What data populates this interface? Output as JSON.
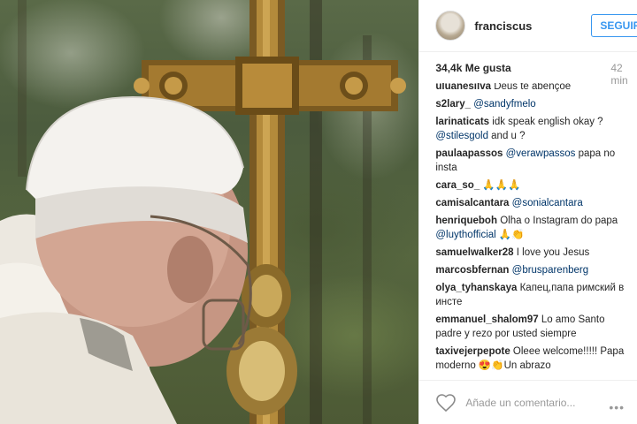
{
  "post": {
    "username": "franciscus",
    "follow_label": "SEGUIR",
    "likes": "34,4k Me gusta",
    "time": "42 min"
  },
  "comments": [
    {
      "user": "uluanesilva",
      "text": "Deus te abençoe",
      "mention": ""
    },
    {
      "user": "s2lary_",
      "text": "",
      "mention": "@sandyfmelo"
    },
    {
      "user": "larinaticats",
      "text": "idk speak english okay ?",
      "mention": "@stilesgold",
      "after": " and u ?"
    },
    {
      "user": "paulaapassos",
      "text": "",
      "mention": "@verawpassos",
      "after": " papa no insta"
    },
    {
      "user": "cara_so_",
      "text": "🙏🙏🙏",
      "mention": ""
    },
    {
      "user": "camisalcantara",
      "text": "",
      "mention": "@sonialcantara"
    },
    {
      "user": "henriqueboh",
      "text": "Olha o Instagram do papa",
      "mention": "@luythofficial",
      "after": " 🙏👏"
    },
    {
      "user": "samuelwalker28",
      "text": "I love you Jesus",
      "mention": ""
    },
    {
      "user": "marcosbfernan",
      "text": "",
      "mention": "@brusparenberg"
    },
    {
      "user": "olya_tyhanskaya",
      "text": "Капец,папа римский в инсте",
      "mention": ""
    },
    {
      "user": "emmanuel_shalom97",
      "text": "Lo amo Santo padre y rezo por usted siempre",
      "mention": ""
    },
    {
      "user": "taxivejerpepote",
      "text": "Oleee welcome!!!!! Papa moderno 😍👏Un abrazo",
      "mention": ""
    }
  ],
  "footer": {
    "add_comment_placeholder": "Añade un comentario...",
    "more_icon": "ellipsis-icon",
    "like_icon": "heart-icon"
  },
  "colors": {
    "accent": "#3897f0",
    "mention": "#003569",
    "muted": "#999999",
    "text": "#262626"
  }
}
